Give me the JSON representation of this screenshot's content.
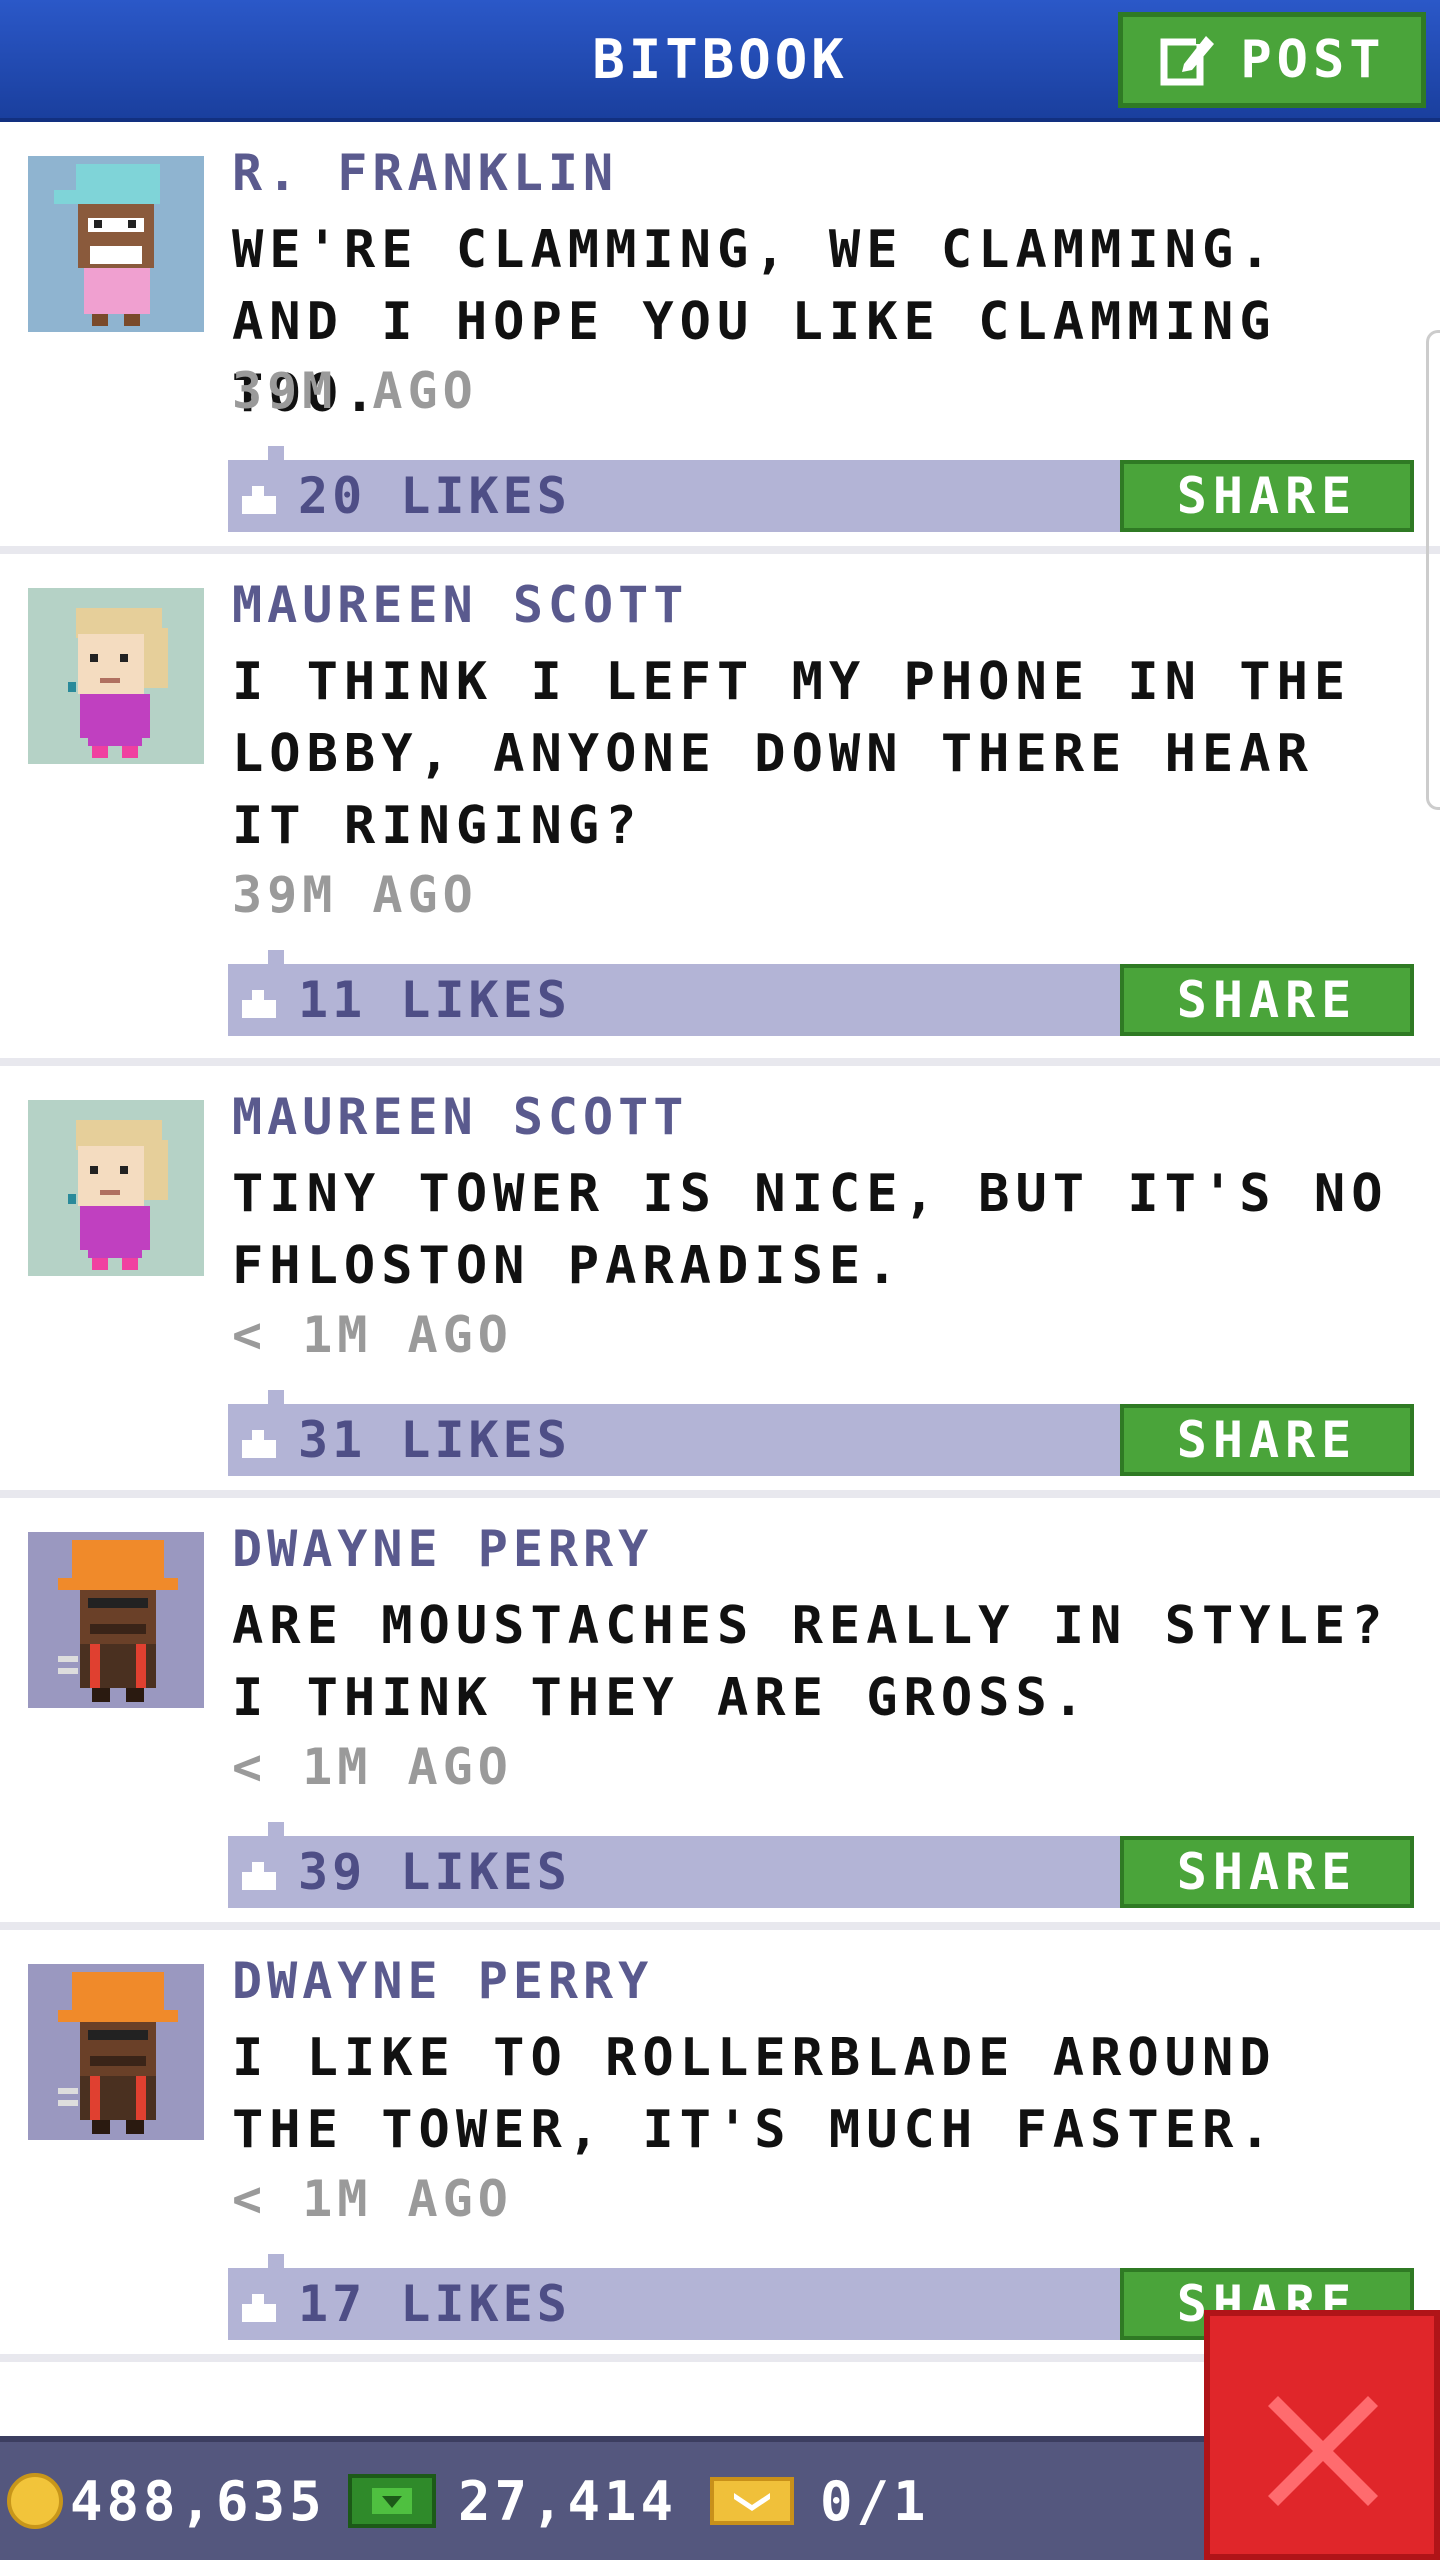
{
  "header": {
    "title": "BITBOOK",
    "post_label": "POST"
  },
  "feed": [
    {
      "author": "R. FRANKLIN",
      "message": "WE'RE CLAMMING, WE CLAMMING. AND I HOPE YOU LIKE CLAMMING TOO.",
      "time": "39M AGO",
      "likes": "20 LIKES",
      "share": "SHARE",
      "avatar": "bitizen-cap-avatar"
    },
    {
      "author": "MAUREEN SCOTT",
      "message": "I THINK I LEFT MY PHONE IN THE LOBBY, ANYONE DOWN THERE HEAR IT RINGING?",
      "time": "39M AGO",
      "likes": "11 LIKES",
      "share": "SHARE",
      "avatar": "bitizen-blonde-avatar"
    },
    {
      "author": "MAUREEN SCOTT",
      "message": "TINY TOWER IS NICE, BUT IT'S NO FHLOSTON PARADISE.",
      "time": "< 1M AGO",
      "likes": "31 LIKES",
      "share": "SHARE",
      "avatar": "bitizen-blonde-avatar"
    },
    {
      "author": "DWAYNE PERRY",
      "message": "ARE MOUSTACHES REALLY IN STYLE? I THINK THEY ARE GROSS.",
      "time": "< 1M AGO",
      "likes": "39 LIKES",
      "share": "SHARE",
      "avatar": "bitizen-hardhat-avatar"
    },
    {
      "author": "DWAYNE PERRY",
      "message": "I LIKE TO ROLLERBLADE AROUND THE TOWER, IT'S MUCH FASTER.",
      "time": "< 1M AGO",
      "likes": "17 LIKES",
      "share": "SHARE",
      "avatar": "bitizen-hardhat-avatar"
    }
  ],
  "status": {
    "coins": "488,635",
    "bux": "27,414",
    "tickets": "0/1"
  },
  "colors": {
    "header_blue": "#2b58c8",
    "share_green": "#4aa43a",
    "like_bar": "#b3b4d6",
    "author_purple": "#5a5a8e",
    "close_red": "#e0262a"
  }
}
